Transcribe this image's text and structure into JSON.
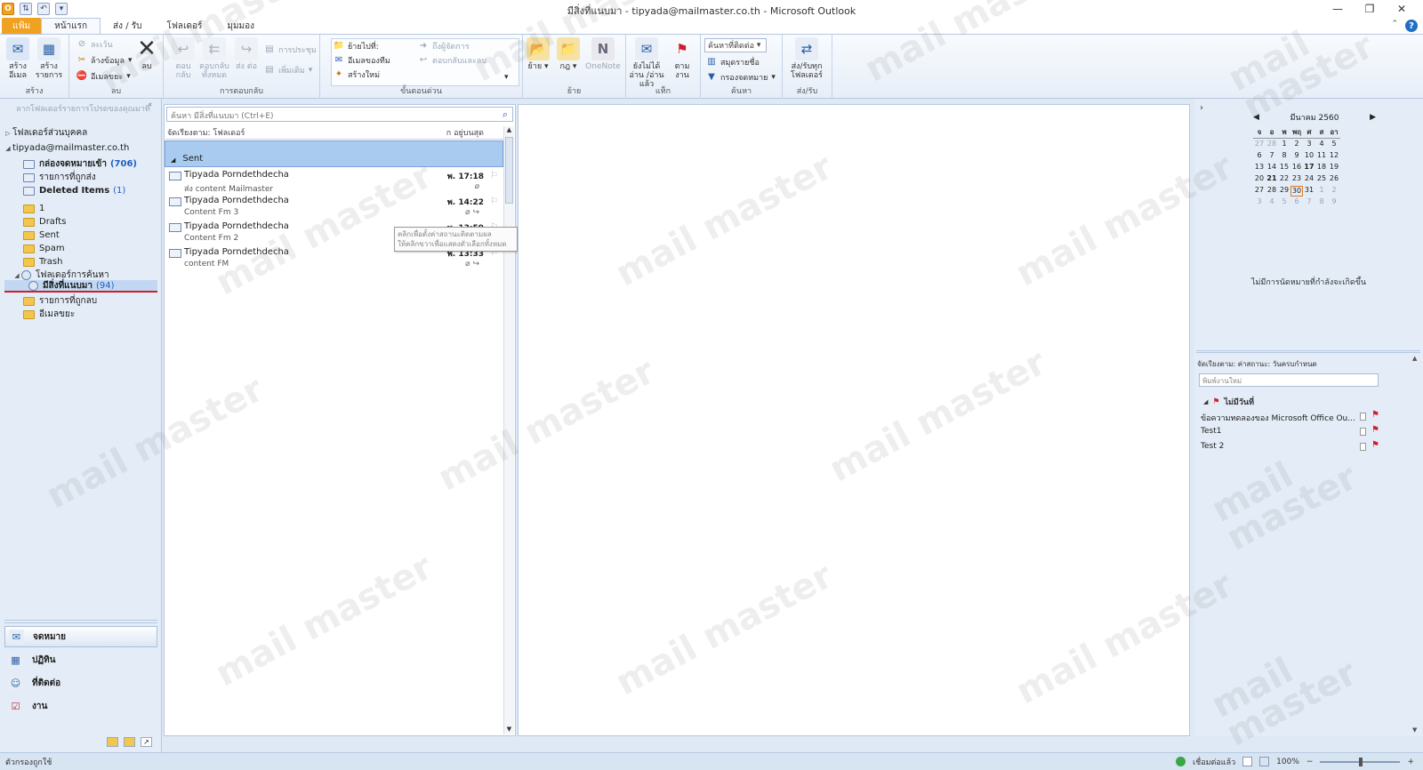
{
  "window": {
    "title": "มีสิ่งที่แนบมา - tipyada@mailmaster.co.th - Microsoft Outlook",
    "controls": [
      "—",
      "❐",
      "✕"
    ]
  },
  "tabs": [
    {
      "label": "แฟ้ม",
      "kind": "file"
    },
    {
      "label": "หน้าแรก",
      "kind": "active"
    },
    {
      "label": "ส่ง / รับ",
      "kind": ""
    },
    {
      "label": "โฟลเดอร์",
      "kind": ""
    },
    {
      "label": "มุมมอง",
      "kind": ""
    }
  ],
  "ribbon": {
    "new": {
      "new_email": "สร้าง อีเมล",
      "new_items": "สร้าง รายการ",
      "label": "สร้าง"
    },
    "delete": {
      "ignore": "ละเว้น",
      "cleanup": "ล้างข้อมูล",
      "junk": "อีเมลขยะ",
      "delete": "ลบ",
      "label": "ลบ"
    },
    "respond": {
      "reply": "ตอบ กลับ",
      "reply_all": "ตอบกลับ ทั้งหมด",
      "forward": "ส่ง ต่อ",
      "meeting": "การประชุม",
      "more": "เพิ่มเติม",
      "label": "การตอบกลับ"
    },
    "quicksteps": {
      "move_to": "ย้ายไปที่:",
      "to_manager": "ถึงผู้จัดการ",
      "team_email": "อีเมลของทีม",
      "reply_delete": "ตอบกลับและลบ",
      "create_new": "สร้างใหม่",
      "label": "ขั้นตอนด่วน"
    },
    "move": {
      "move": "ย้าย",
      "rules": "กฎ",
      "onenote": "OneNote",
      "label": "ย้าย"
    },
    "tags": {
      "unread": "ยังไม่ได้อ่าน /อ่านแล้ว",
      "followup": "ตาม งาน",
      "label": "แท็ก"
    },
    "find": {
      "search_people": "ค้นหาที่ติดต่อ",
      "address_book": "สมุดรายชื่อ",
      "filter_email": "กรองจดหมาย",
      "label": "ค้นหา"
    },
    "sendreceive": {
      "all": "ส่ง/รับทุก โฟลเดอร์",
      "label": "ส่ง/รับ"
    }
  },
  "nav": {
    "hint": "ลากโฟลเดอร์รายการโปรดของคุณมาที่",
    "favorites": "โฟลเดอร์ส่วนบุคคล",
    "account": "tipyada@mailmaster.co.th",
    "inbox": "กล่องจดหมายเข้า",
    "inbox_count": "(706)",
    "sent_items": "รายการที่ถูกส่ง",
    "deleted": "Deleted Items",
    "deleted_count": "(1)",
    "folders": [
      "1",
      "Drafts",
      "Sent",
      "Spam",
      "Trash"
    ],
    "search_folders": "โฟลเดอร์การค้นหา",
    "attachments": "มีสิ่งที่แนบมา",
    "attachments_count": "(94)",
    "deleted_list": "รายการที่ถูกลบ",
    "junk": "อีเมลขยะ",
    "buttons": [
      "จดหมาย",
      "ปฏิทิน",
      "ที่ติดต่อ",
      "งาน"
    ]
  },
  "list": {
    "search_placeholder": "ค้นหา มีสิ่งที่แนบมา (Ctrl+E)",
    "arrange_by": "จัดเรียงตาม: โฟลเดอร์",
    "sort_order": "ก อยู่บนสุด",
    "group": "Sent",
    "messages": [
      {
        "from": "Tipyada Porndethdecha",
        "subject": "ส่ง content Mailmaster",
        "time": "พ. 17:18"
      },
      {
        "from": "Tipyada Porndethdecha",
        "subject": "Content Fm 3",
        "time": "พ. 14:22"
      },
      {
        "from": "Tipyada Porndethdecha",
        "subject": "Content Fm 2",
        "time": "พ. 13:59"
      },
      {
        "from": "Tipyada Porndethdecha",
        "subject": "content FM",
        "time": "พ. 13:33"
      }
    ],
    "tooltip": "คลิกเพื่อตั้งค่าสถานะติดตามผล\nให้คลิกขวาเพื่อแสดงตัวเลือกทั้งหมด"
  },
  "todo": {
    "month": "มีนาคม 2560",
    "dow": [
      "จ",
      "อ",
      "พ",
      "พฤ",
      "ศ",
      "ส",
      "อา"
    ],
    "days": [
      "27",
      "28",
      "1",
      "2",
      "3",
      "4",
      "5",
      "6",
      "7",
      "8",
      "9",
      "10",
      "11",
      "12",
      "13",
      "14",
      "15",
      "16",
      "17",
      "18",
      "19",
      "20",
      "21",
      "22",
      "23",
      "24",
      "25",
      "26",
      "27",
      "28",
      "29",
      "30",
      "31",
      "1",
      "2",
      "3",
      "4",
      "5",
      "6",
      "7",
      "8",
      "9"
    ],
    "no_appointments": "ไม่มีการนัดหมายที่กำลังจะเกิดขึ้น",
    "task_arrange": "จัดเรียงตาม: ค่าสถานะ: วันครบกำหนด",
    "task_new_placeholder": "พิมพ์งานใหม่",
    "task_group": "ไม่มีวันที่",
    "tasks": [
      "ข้อความทดลองของ Microsoft Office Ou...",
      "Test1",
      "Test 2"
    ]
  },
  "status": {
    "left": "ตัวกรองถูกใช้",
    "connected": "เชื่อมต่อแล้ว",
    "zoom": "100%"
  },
  "watermark": "mail master",
  "colors": {
    "accent": "#f0a11f",
    "selection": "#a9cbf0",
    "flag": "#d11d2a"
  }
}
